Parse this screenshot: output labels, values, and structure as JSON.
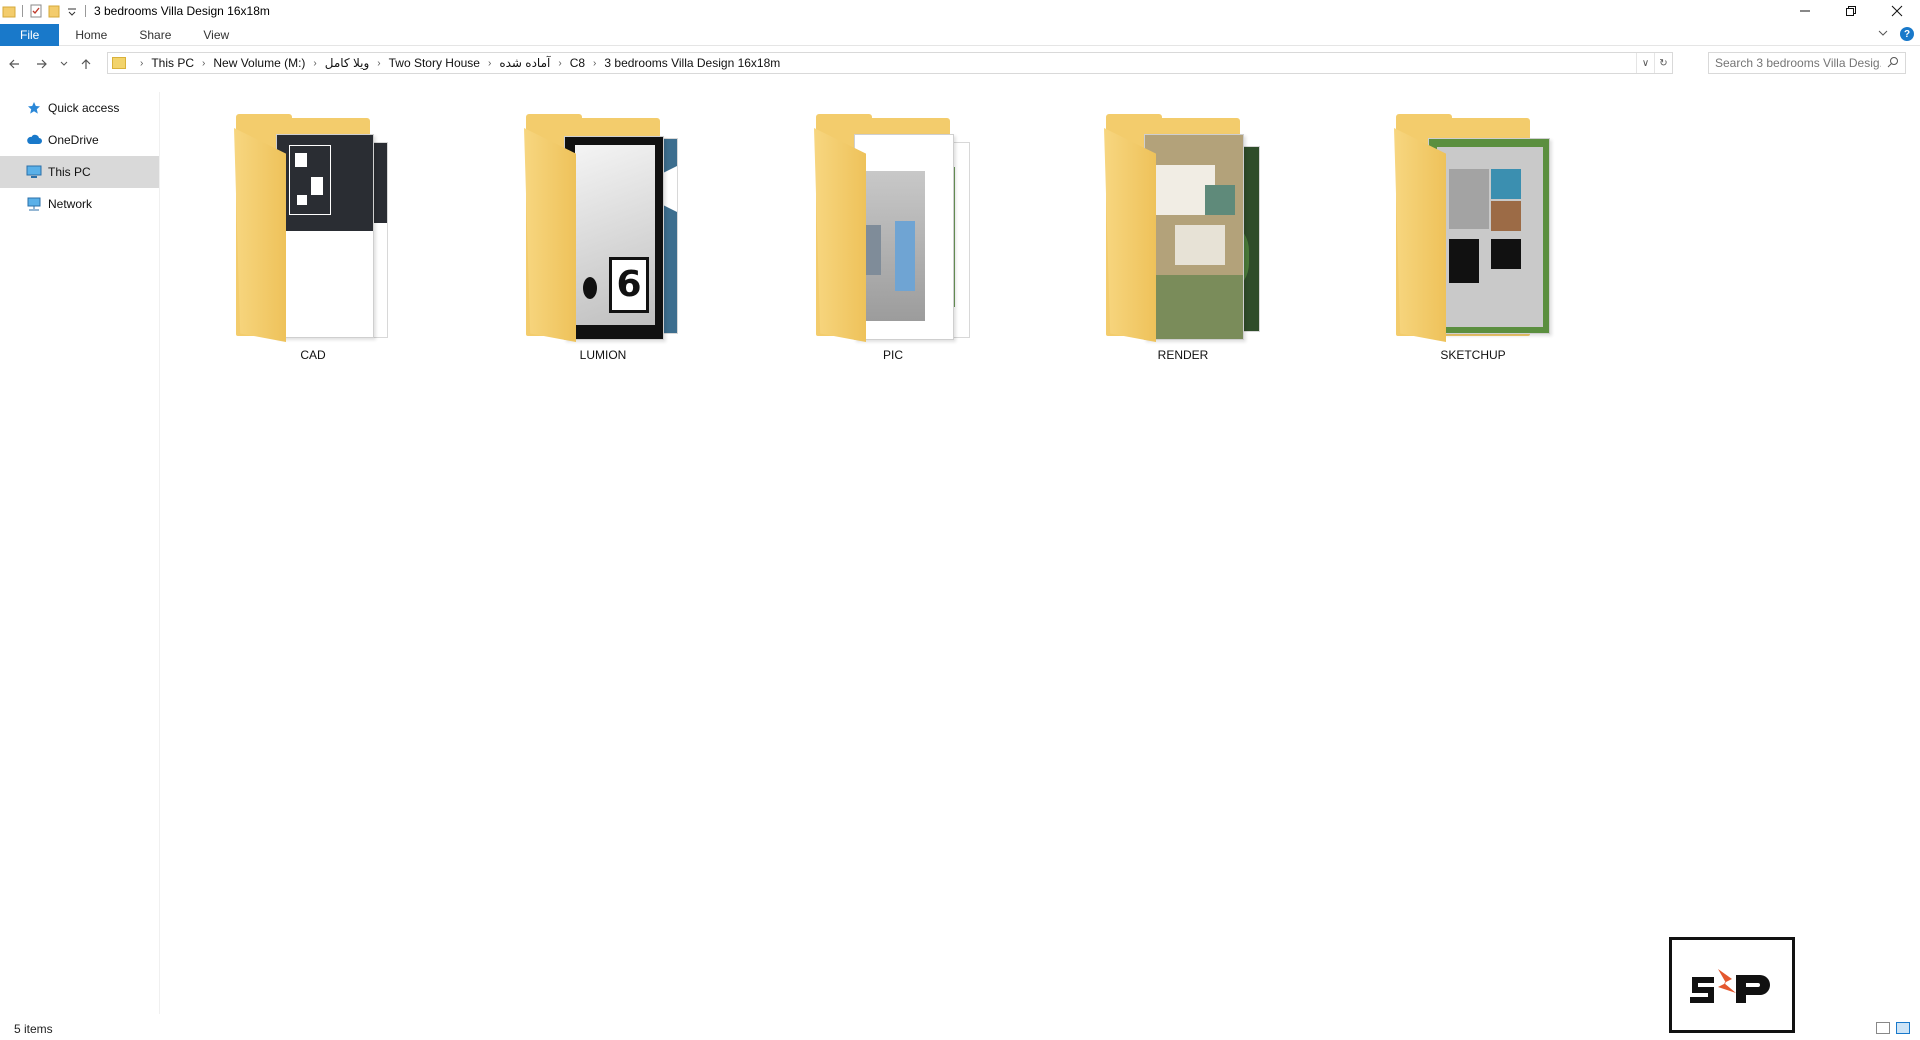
{
  "window": {
    "title": "3 bedrooms Villa Design 16x18m"
  },
  "ribbon": {
    "tabs": [
      "File",
      "Home",
      "Share",
      "View"
    ]
  },
  "address": {
    "crumbs": [
      "This PC",
      "New Volume (M:)",
      "ویلا کامل",
      "Two Story House",
      "آماده شده",
      "C8",
      "3 bedrooms Villa Design 16x18m"
    ]
  },
  "search": {
    "placeholder": "Search 3 bedrooms Villa Desig..."
  },
  "sidebar": {
    "items": [
      {
        "label": "Quick access",
        "icon": "star-icon"
      },
      {
        "label": "OneDrive",
        "icon": "cloud-icon"
      },
      {
        "label": "This PC",
        "icon": "computer-icon",
        "selected": true
      },
      {
        "label": "Network",
        "icon": "network-icon"
      }
    ]
  },
  "folders": [
    {
      "name": "CAD"
    },
    {
      "name": "LUMION"
    },
    {
      "name": "PIC"
    },
    {
      "name": "RENDER"
    },
    {
      "name": "SKETCHUP"
    }
  ],
  "status": {
    "item_count": "5 items"
  },
  "colors": {
    "accent": "#1979ca",
    "folder": "#f3cc6c",
    "selected_nav": "#d9d9d9"
  }
}
